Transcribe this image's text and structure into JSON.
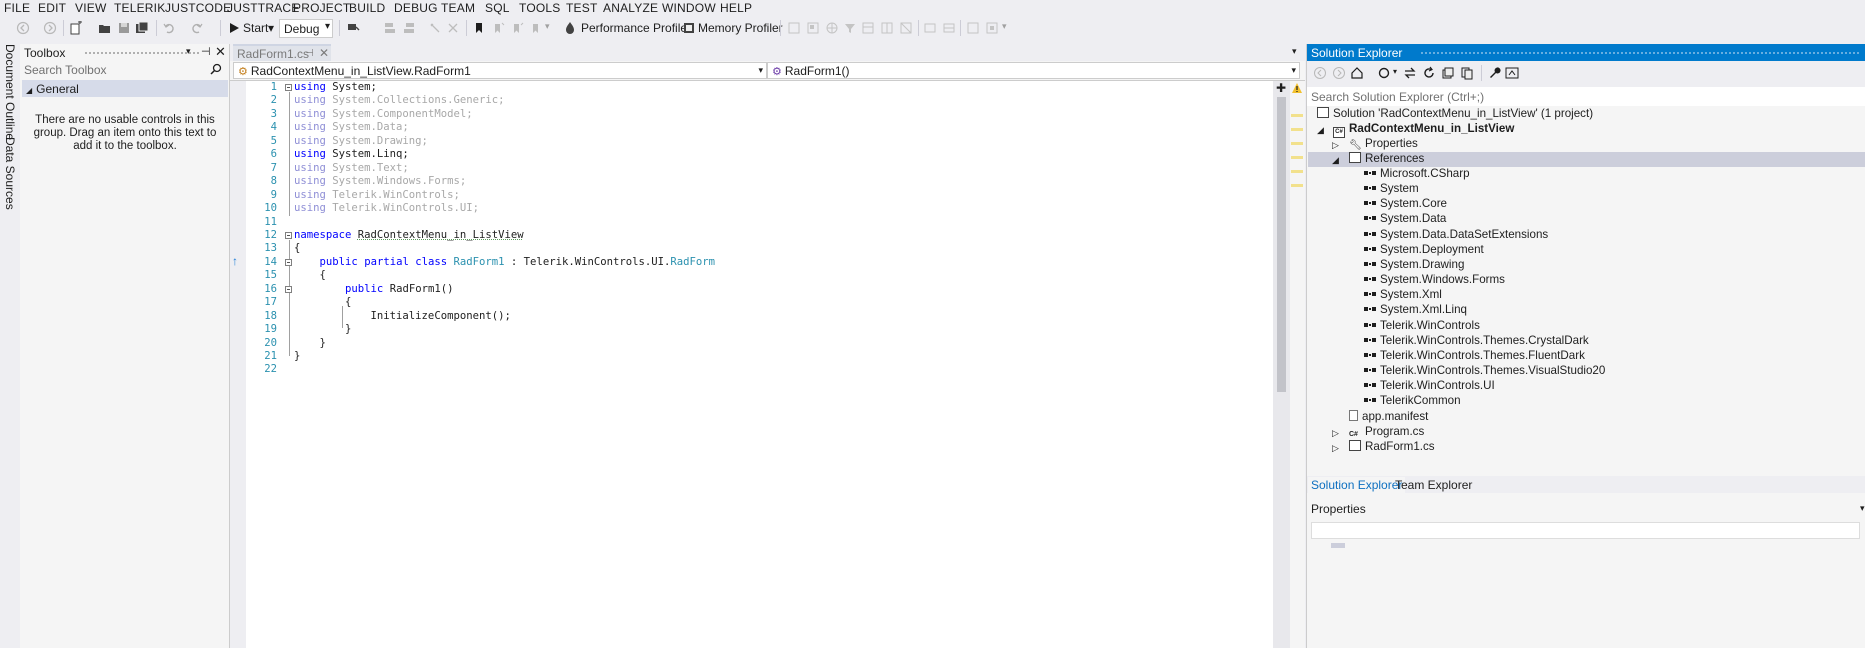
{
  "menu": [
    "FILE",
    "EDIT",
    "VIEW",
    "TELERIK",
    "JUSTCODE",
    "JUSTTRACE",
    "PROJECT",
    "BUILD",
    "DEBUG",
    "TEAM",
    "SQL",
    "TOOLS",
    "TEST",
    "ANALYZE",
    "WINDOW",
    "HELP"
  ],
  "toolbar": {
    "start_label": "Start",
    "config_value": "Debug",
    "perf_profiler_label": "Performance Profiler",
    "memory_profiler_label": "Memory Profiler"
  },
  "left_tabs": [
    "Document Outline",
    "Data Sources"
  ],
  "toolbox": {
    "title": "Toolbox",
    "search_placeholder": "Search Toolbox",
    "group": "General",
    "message": "There are no usable controls in this group. Drag an item onto this text to add it to the toolbox."
  },
  "editor": {
    "tab_label": "RadForm1.cs",
    "nav_left": "RadContextMenu_in_ListView.RadForm1",
    "nav_right": "RadForm1()",
    "lines": [
      {
        "n": "1",
        "text": "using System;"
      },
      {
        "n": "2",
        "text": "using System.Collections.Generic;"
      },
      {
        "n": "3",
        "text": "using System.ComponentModel;"
      },
      {
        "n": "4",
        "text": "using System.Data;"
      },
      {
        "n": "5",
        "text": "using System.Drawing;"
      },
      {
        "n": "6",
        "text": "using System.Linq;"
      },
      {
        "n": "7",
        "text": "using System.Text;"
      },
      {
        "n": "8",
        "text": "using System.Windows.Forms;"
      },
      {
        "n": "9",
        "text": "using Telerik.WinControls;"
      },
      {
        "n": "10",
        "text": "using Telerik.WinControls.UI;"
      },
      {
        "n": "11",
        "text": ""
      },
      {
        "n": "12",
        "text": "namespace RadContextMenu_in_ListView"
      },
      {
        "n": "13",
        "text": "{"
      },
      {
        "n": "14",
        "text": "    public partial class RadForm1 : Telerik.WinControls.UI.RadForm"
      },
      {
        "n": "15",
        "text": "    {"
      },
      {
        "n": "16",
        "text": "        public RadForm1()"
      },
      {
        "n": "17",
        "text": "        {"
      },
      {
        "n": "18",
        "text": "            InitializeComponent();"
      },
      {
        "n": "19",
        "text": "        }"
      },
      {
        "n": "20",
        "text": "    }"
      },
      {
        "n": "21",
        "text": "}"
      },
      {
        "n": "22",
        "text": ""
      }
    ]
  },
  "solution_explorer": {
    "title": "Solution Explorer",
    "search_placeholder": "Search Solution Explorer (Ctrl+;)",
    "solution": "Solution 'RadContextMenu_in_ListView' (1 project)",
    "project": "RadContextMenu_in_ListView",
    "properties": "Properties",
    "references": "References",
    "reference_items": [
      "Microsoft.CSharp",
      "System",
      "System.Core",
      "System.Data",
      "System.Data.DataSetExtensions",
      "System.Deployment",
      "System.Drawing",
      "System.Windows.Forms",
      "System.Xml",
      "System.Xml.Linq",
      "Telerik.WinControls",
      "Telerik.WinControls.Themes.CrystalDark",
      "Telerik.WinControls.Themes.FluentDark",
      "Telerik.WinControls.Themes.VisualStudio20",
      "Telerik.WinControls.UI",
      "TelerikCommon"
    ],
    "files": [
      "app.manifest",
      "Program.cs",
      "RadForm1.cs"
    ],
    "bottom_tabs": [
      "Solution Explorer",
      "Team Explorer"
    ],
    "properties_panel_title": "Properties"
  },
  "colors": {
    "accent": "#007acc",
    "keyword": "#0000ff",
    "type": "#2b91af"
  }
}
